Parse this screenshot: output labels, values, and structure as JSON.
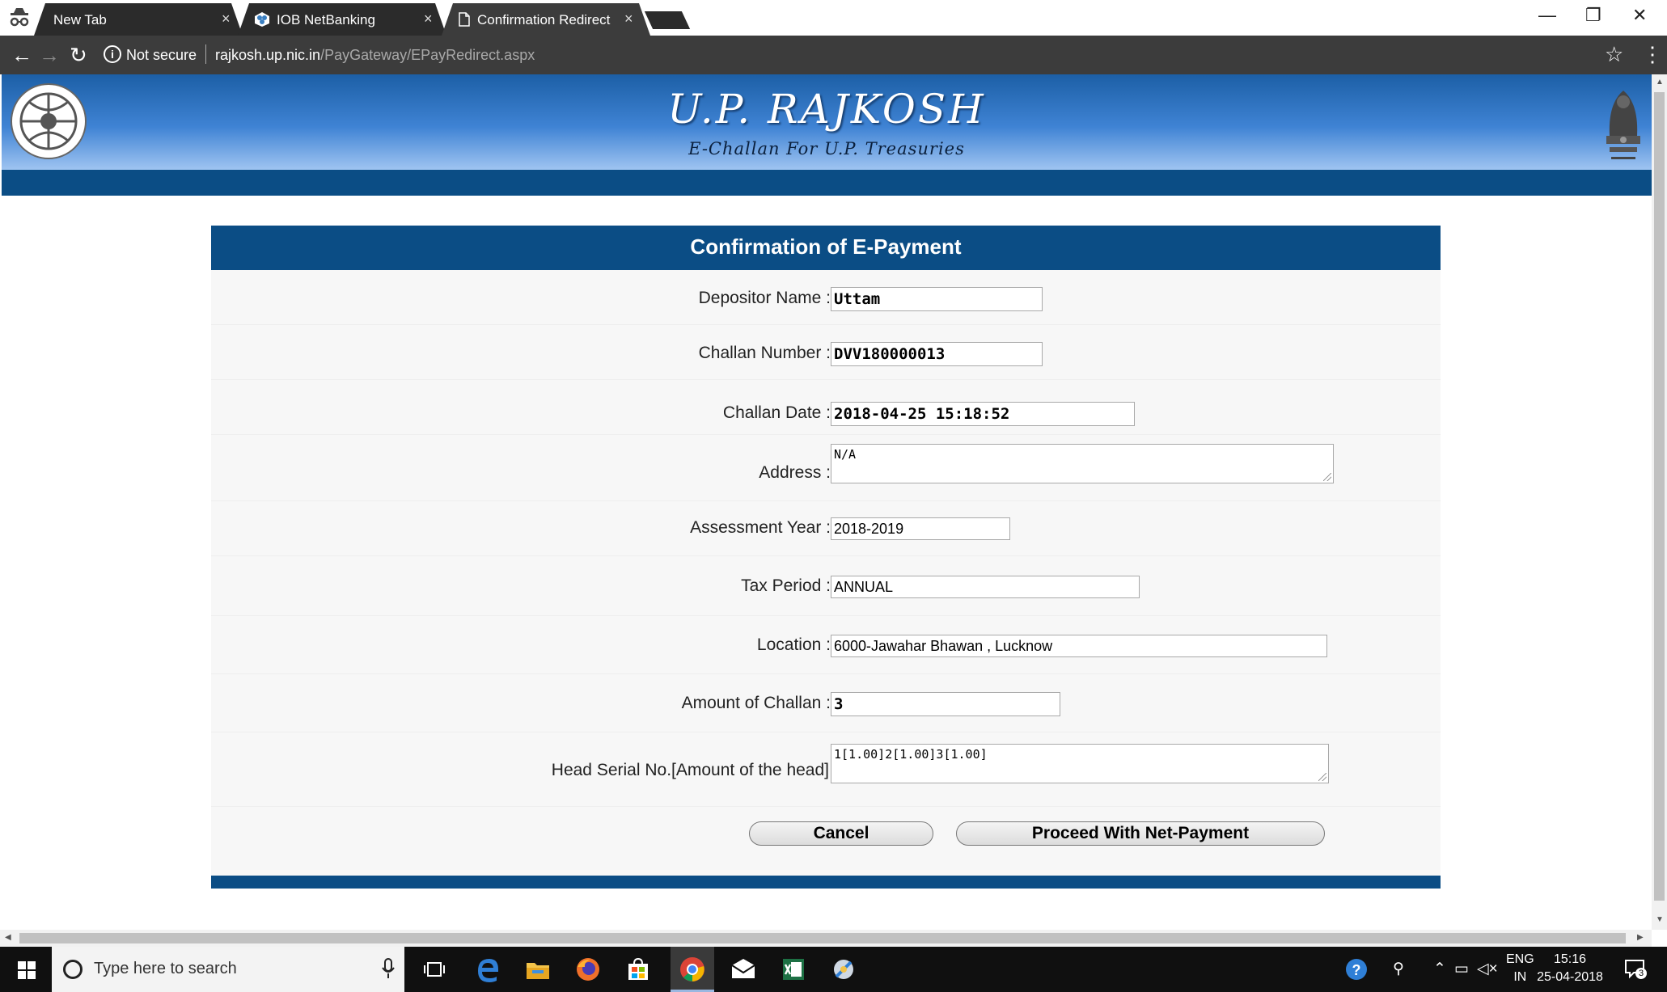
{
  "browser": {
    "tabs": [
      {
        "title": "New Tab",
        "close": "×"
      },
      {
        "title": "IOB NetBanking",
        "close": "×"
      },
      {
        "title": "Confirmation Redirect",
        "close": "×"
      }
    ],
    "security_label": "Not secure",
    "url_host": "rajkosh.up.nic.in",
    "url_path": "/PayGateway/EPayRedirect.aspx",
    "window_controls": {
      "minimize": "—",
      "restore": "❐",
      "close": "✕"
    },
    "nav": {
      "back": "←",
      "forward": "→",
      "reload": "↻"
    },
    "bookmark_icon": "☆",
    "menu_icon": "⋮"
  },
  "header": {
    "title": "U.P. RAJKOSH",
    "subtitle": "E-Challan For U.P. Treasuries"
  },
  "form": {
    "heading": "Confirmation of E-Payment",
    "fields": [
      {
        "label": "Depositor Name :",
        "value": "Uttam"
      },
      {
        "label": "Challan Number :",
        "value": "DVV180000013"
      },
      {
        "label": "Challan Date :",
        "value": "2018-04-25 15:18:52"
      },
      {
        "label": "Address :",
        "value": "N/A"
      },
      {
        "label": "Assessment Year :",
        "value": "2018-2019"
      },
      {
        "label": "Tax Period :",
        "value": "ANNUAL"
      },
      {
        "label": "Location :",
        "value": "6000-Jawahar Bhawan , Lucknow"
      },
      {
        "label": "Amount of Challan :",
        "value": "3"
      },
      {
        "label": "Head  Serial No.[Amount of the head]",
        "value": "1[1.00]2[1.00]3[1.00]"
      }
    ],
    "cancel_label": "Cancel",
    "proceed_label": "Proceed With Net-Payment"
  },
  "taskbar": {
    "search_placeholder": "Type here to search",
    "lang_top": "ENG",
    "lang_bottom": "IN",
    "time": "15:16",
    "date": "25-04-2018",
    "notifications": "3"
  },
  "colors": {
    "banner_dark": "#0b4d85",
    "banner_gradient_top": "#1c5fa6",
    "banner_gradient_bottom": "#9fc4f1",
    "chrome_toolbar": "#3c3c3c",
    "taskbar": "#101010"
  }
}
